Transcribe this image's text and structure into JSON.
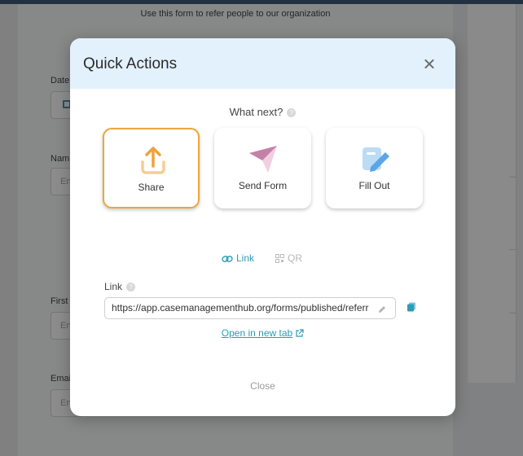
{
  "background": {
    "intro_text": "Use this form to refer people to our organization",
    "labels": {
      "date": "Date",
      "name": "Nam",
      "first": "First",
      "email": "Emai"
    },
    "input_placeholder": "En"
  },
  "modal": {
    "title": "Quick Actions",
    "prompt": "What next?",
    "help_glyph": "?",
    "actions": [
      {
        "label": "Share",
        "icon": "upload-icon",
        "selected": true
      },
      {
        "label": "Send Form",
        "icon": "paper-plane-icon",
        "selected": false
      },
      {
        "label": "Fill Out",
        "icon": "edit-document-icon",
        "selected": false
      }
    ],
    "tabs": [
      {
        "label": "Link",
        "icon": "link-icon",
        "active": true
      },
      {
        "label": "QR",
        "icon": "qr-icon",
        "active": false
      }
    ],
    "link_label": "Link",
    "link_value": "https://app.casemanagementhub.org/forms/published/referr",
    "open_tab_label": "Open in new tab",
    "close_label": "Close"
  },
  "colors": {
    "accent": "#2d9bb5",
    "selected_border": "#eba73c",
    "header_bg": "#e2f1fc",
    "send_icon": "#c580a8",
    "fill_icon": "#5aa6e6"
  }
}
